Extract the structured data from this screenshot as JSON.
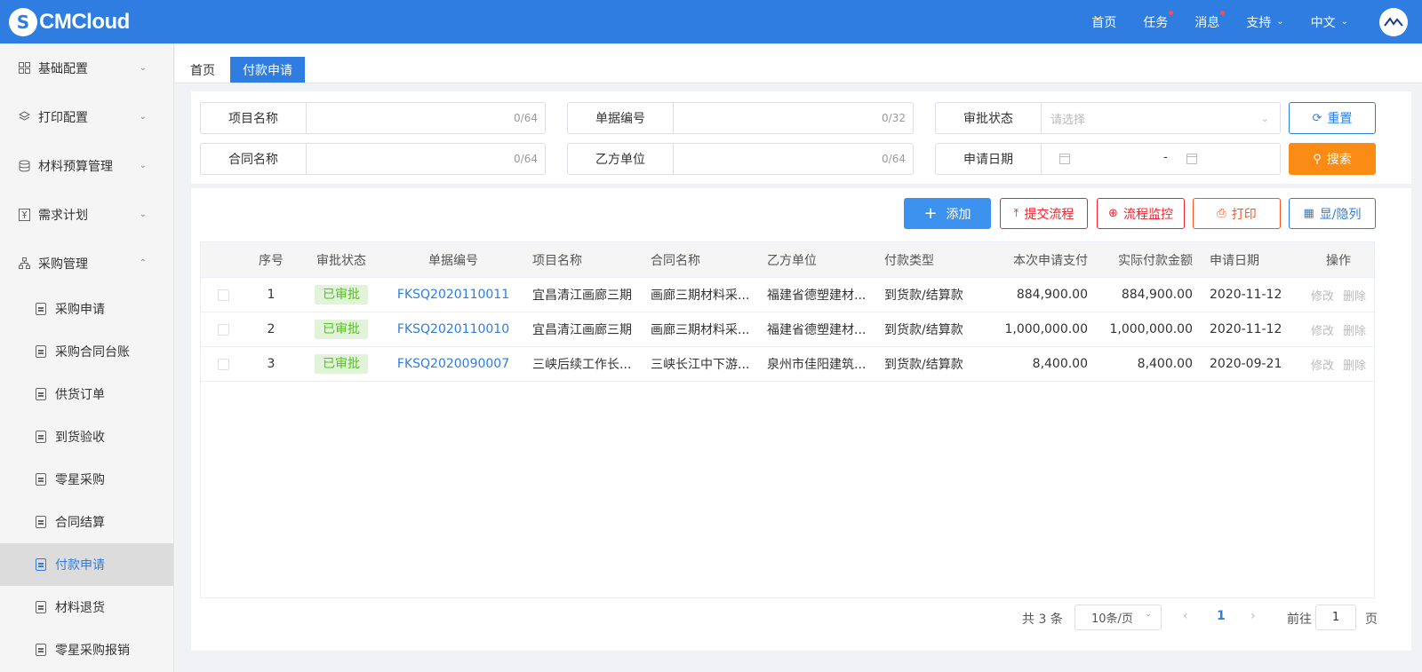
{
  "header": {
    "logo_text": "CMCloud",
    "nav": [
      {
        "label": "首页",
        "dot": false,
        "caret": false
      },
      {
        "label": "任务",
        "dot": true,
        "caret": false
      },
      {
        "label": "消息",
        "dot": true,
        "caret": false
      },
      {
        "label": "支持",
        "dot": false,
        "caret": true
      },
      {
        "label": "中文",
        "dot": false,
        "caret": true
      }
    ]
  },
  "sidebar": {
    "groups": [
      {
        "label": "基础配置",
        "icon": "grid-icon",
        "arrow": "chevron-down-icon"
      },
      {
        "label": "打印配置",
        "icon": "layers-icon",
        "arrow": "chevron-down-icon"
      },
      {
        "label": "材料预算管理",
        "icon": "database-icon",
        "arrow": "chevron-down-icon"
      },
      {
        "label": "需求计划",
        "icon": "yen-document-icon",
        "arrow": "chevron-down-icon"
      },
      {
        "label": "采购管理",
        "icon": "org-chart-icon",
        "arrow": "chevron-up-icon"
      }
    ],
    "items": [
      {
        "label": "采购申请",
        "active": false
      },
      {
        "label": "采购合同台账",
        "active": false
      },
      {
        "label": "供货订单",
        "active": false
      },
      {
        "label": "到货验收",
        "active": false
      },
      {
        "label": "零星采购",
        "active": false
      },
      {
        "label": "合同结算",
        "active": false
      },
      {
        "label": "付款申请",
        "active": true
      },
      {
        "label": "材料退货",
        "active": false
      },
      {
        "label": "零星采购报销",
        "active": false
      }
    ]
  },
  "tabs": {
    "home": "首页",
    "active": "付款申请"
  },
  "search": {
    "project_name": {
      "label": "项目名称",
      "counter": "0/64"
    },
    "doc_no": {
      "label": "单据编号",
      "counter": "0/32"
    },
    "approval_status": {
      "label": "审批状态",
      "placeholder": "请选择"
    },
    "contract_name": {
      "label": "合同名称",
      "counter": "0/64"
    },
    "party_b": {
      "label": "乙方单位",
      "counter": "0/64"
    },
    "apply_date": {
      "label": "申请日期",
      "separator": "-"
    },
    "reset_label": "重置",
    "search_label": "搜索"
  },
  "toolbar": {
    "add": "添加",
    "submit_flow": "提交流程",
    "monitor_flow": "流程监控",
    "print": "打印",
    "toggle_columns": "显/隐列"
  },
  "table": {
    "headers": {
      "index": "序号",
      "status": "审批状态",
      "doc_no": "单据编号",
      "project": "项目名称",
      "contract": "合同名称",
      "party_b": "乙方单位",
      "pay_type": "付款类型",
      "apply_amount": "本次申请支付",
      "actual_amount": "实际付款金额",
      "apply_date": "申请日期",
      "ops": "操作"
    },
    "rows": [
      {
        "index": "1",
        "status": "已审批",
        "doc_no": "FKSQ2020110011",
        "project": "宜昌清江画廊三期",
        "contract": "画廊三期材料采...",
        "party_b": "福建省德塑建材...",
        "pay_type": "到货款/结算款",
        "apply_amount": "884,900.00",
        "actual_amount": "884,900.00",
        "apply_date": "2020-11-12",
        "edit": "修改",
        "delete": "删除"
      },
      {
        "index": "2",
        "status": "已审批",
        "doc_no": "FKSQ2020110010",
        "project": "宜昌清江画廊三期",
        "contract": "画廊三期材料采...",
        "party_b": "福建省德塑建材...",
        "pay_type": "到货款/结算款",
        "apply_amount": "1,000,000.00",
        "actual_amount": "1,000,000.00",
        "apply_date": "2020-11-12",
        "edit": "修改",
        "delete": "删除"
      },
      {
        "index": "3",
        "status": "已审批",
        "doc_no": "FKSQ2020090007",
        "project": "三峡后续工作长...",
        "contract": "三峡长江中下游...",
        "party_b": "泉州市佳阳建筑...",
        "pay_type": "到货款/结算款",
        "apply_amount": "8,400.00",
        "actual_amount": "8,400.00",
        "apply_date": "2020-09-21",
        "edit": "修改",
        "delete": "删除"
      }
    ]
  },
  "pagination": {
    "total": "共 3 条",
    "page_size": "10条/页",
    "current": "1",
    "goto_label": "前往",
    "goto_value": "1",
    "unit": "页"
  },
  "colors": {
    "primary": "#2f7de1",
    "search": "#fa8c16",
    "danger": "#f5222d",
    "print": "#fa541c",
    "approved_bg": "#e1f3d8",
    "approved_text": "#52c41a"
  }
}
